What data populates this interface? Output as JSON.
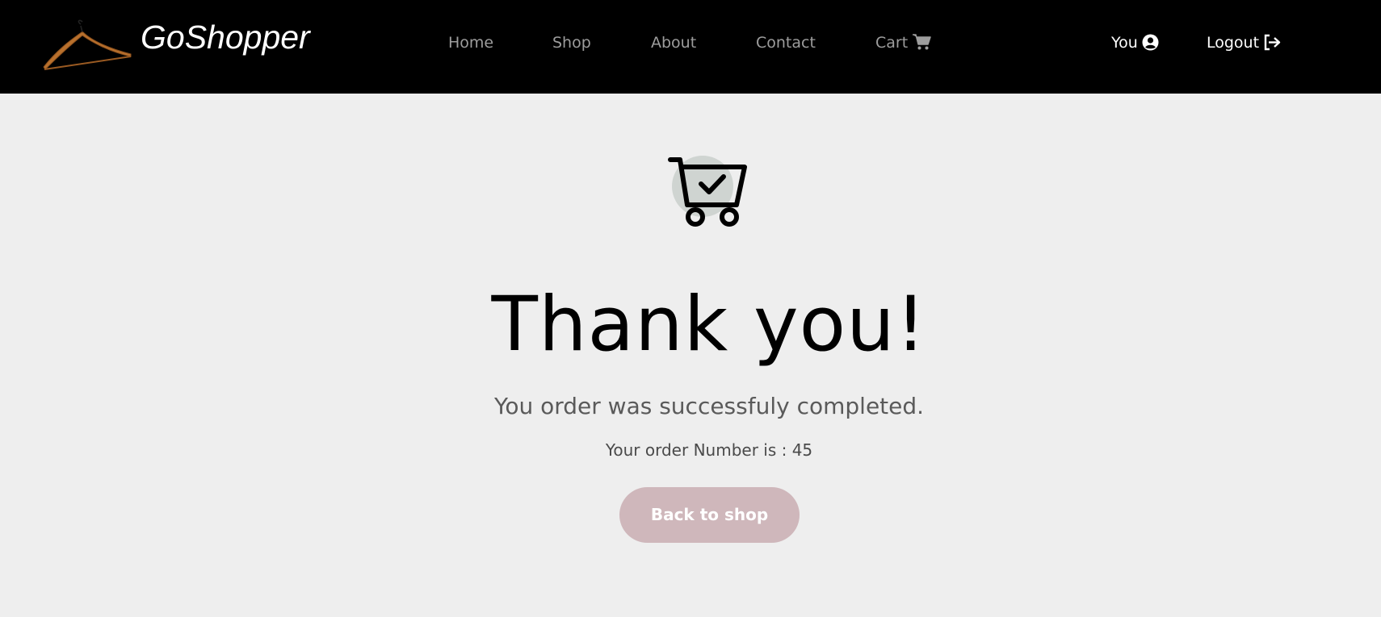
{
  "header": {
    "brand": "GoShopper",
    "logo_icon": "hanger-icon",
    "nav": {
      "home": "Home",
      "shop": "Shop",
      "about": "About",
      "contact": "Contact",
      "cart": "Cart"
    },
    "user_label": "You",
    "logout_label": "Logout",
    "icons": {
      "cart": "cart-icon",
      "user": "user-circle-icon",
      "logout": "logout-icon"
    }
  },
  "main": {
    "hero_icon": "cart-check-icon",
    "title": "Thank you!",
    "subtitle": "You order was successfuly completed.",
    "order_line": "Your order Number is : 45",
    "back_button": "Back to shop"
  },
  "colors": {
    "navbar_bg": "#000000",
    "page_bg": "#eeeeee",
    "nav_link": "#9d9d9d",
    "button_bg": "#cfb7bb",
    "hanger": "#b8702d"
  }
}
